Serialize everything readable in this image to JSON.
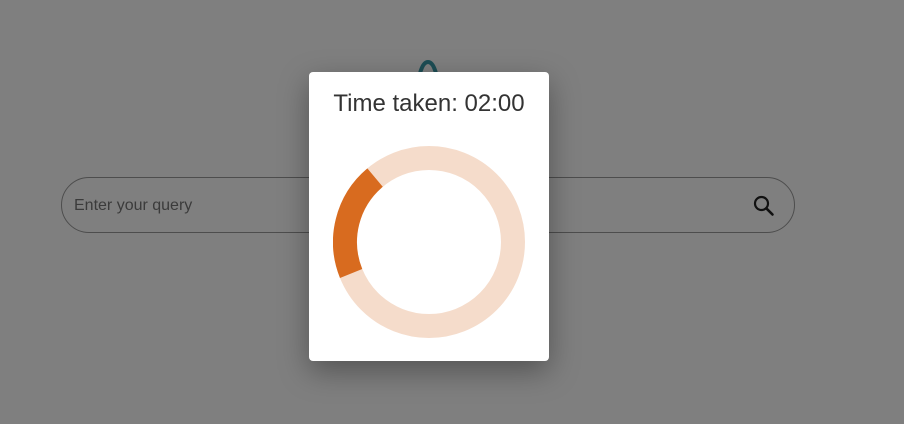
{
  "search": {
    "placeholder": "Enter your query",
    "icon": "search-icon"
  },
  "logo": {
    "icon": "logo-icon",
    "color": "#3a9aa8"
  },
  "modal": {
    "title": "Time taken: 02:00",
    "progress_fraction": 0.2,
    "progress_color": "#d86b1f",
    "track_color": "#f5dccb"
  }
}
